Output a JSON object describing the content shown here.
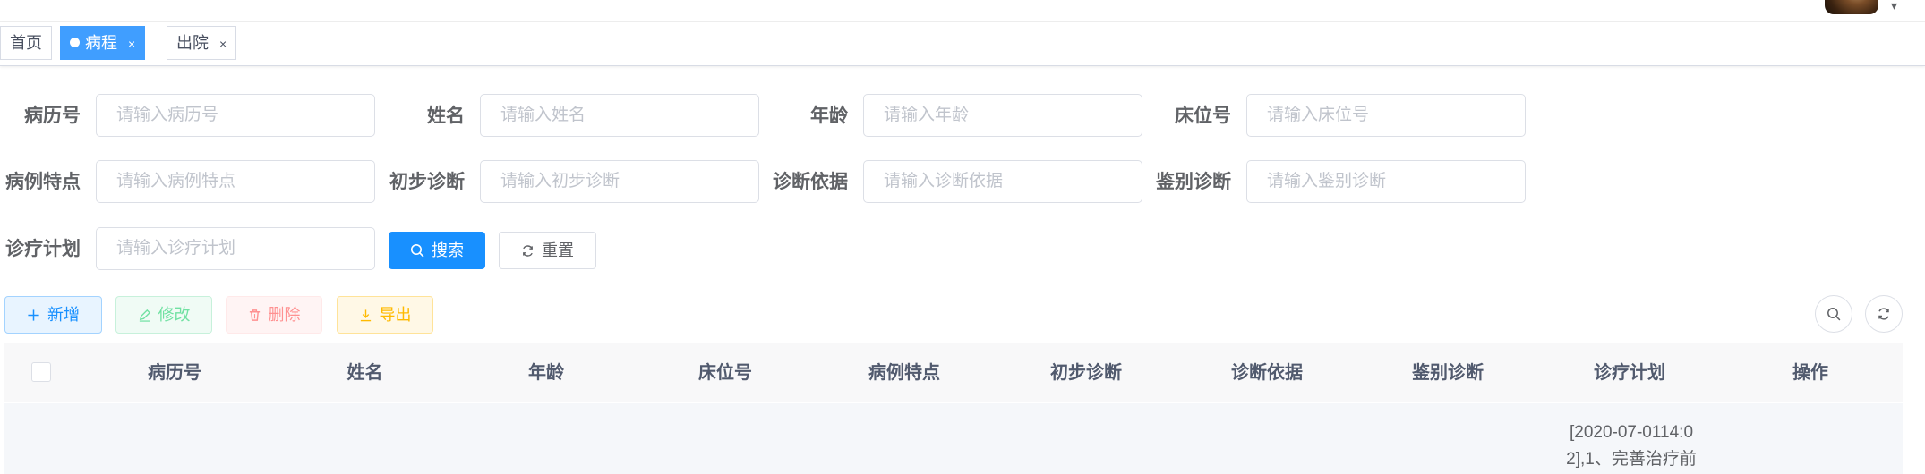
{
  "navbar": {
    "caret": "▾"
  },
  "tags": {
    "home": "首页",
    "course": "病程",
    "discharge": "出院",
    "close": "×"
  },
  "search": {
    "fields": [
      {
        "label": "病历号",
        "placeholder": "请输入病历号"
      },
      {
        "label": "姓名",
        "placeholder": "请输入姓名"
      },
      {
        "label": "年龄",
        "placeholder": "请输入年龄"
      },
      {
        "label": "床位号",
        "placeholder": "请输入床位号"
      },
      {
        "label": "病例特点",
        "placeholder": "请输入病例特点"
      },
      {
        "label": "初步诊断",
        "placeholder": "请输入初步诊断"
      },
      {
        "label": "诊断依据",
        "placeholder": "请输入诊断依据"
      },
      {
        "label": "鉴别诊断",
        "placeholder": "请输入鉴别诊断"
      },
      {
        "label": "诊疗计划",
        "placeholder": "请输入诊疗计划"
      }
    ],
    "search_label": "搜索",
    "reset_label": "重置"
  },
  "toolbar": {
    "add_label": "新增",
    "edit_label": "修改",
    "delete_label": "删除",
    "export_label": "导出"
  },
  "table": {
    "columns": [
      "病历号",
      "姓名",
      "年龄",
      "床位号",
      "病例特点",
      "初步诊断",
      "诊断依据",
      "鉴别诊断",
      "诊疗计划",
      "操作"
    ],
    "rows": [
      {
        "plan_line1": "[2020-07-0114:0",
        "plan_line2": "2],1、完善治疗前"
      }
    ]
  },
  "colors": {
    "primary": "#1890ff",
    "success": "#13ce66",
    "danger": "#ff4949",
    "warning": "#ffba00",
    "active_tag": "#409eff"
  }
}
